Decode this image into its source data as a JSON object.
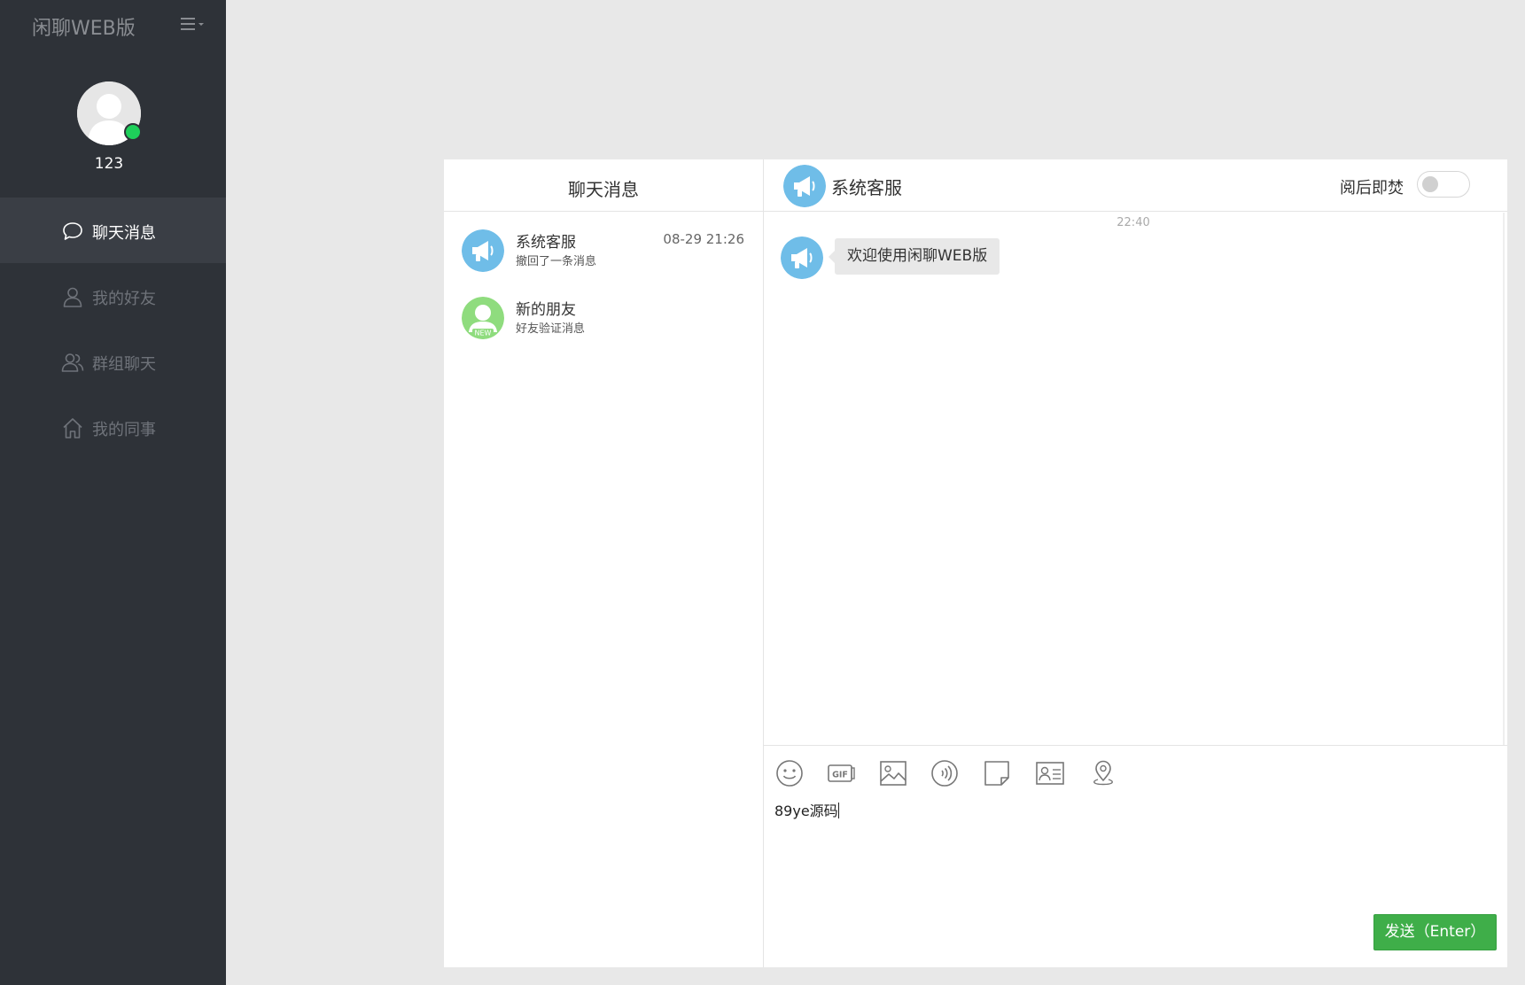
{
  "app": {
    "title": "闲聊WEB版"
  },
  "profile": {
    "username": "123",
    "status": "online"
  },
  "nav": {
    "items": [
      {
        "label": "聊天消息",
        "icon": "chat-bubble-icon",
        "active": true
      },
      {
        "label": "我的好友",
        "icon": "user-icon",
        "active": false
      },
      {
        "label": "群组聊天",
        "icon": "users-icon",
        "active": false
      },
      {
        "label": "我的同事",
        "icon": "home-icon",
        "active": false
      }
    ]
  },
  "conversations": {
    "header": "聊天消息",
    "items": [
      {
        "name": "系统客服",
        "preview": "撤回了一条消息",
        "time": "08-29 21:26",
        "avatar": "megaphone-icon"
      },
      {
        "name": "新的朋友",
        "preview": "好友验证消息",
        "time": "",
        "avatar": "new-friend-icon",
        "badge": "NEW"
      }
    ]
  },
  "chat": {
    "contact_name": "系统客服",
    "burn_after_read_label": "阅后即焚",
    "burn_after_read_enabled": false,
    "messages": [
      {
        "time": "22:40",
        "text": "欢迎使用闲聊WEB版",
        "sender": "系统客服"
      }
    ],
    "toolbar": [
      {
        "name": "emoji-icon"
      },
      {
        "name": "gif-icon"
      },
      {
        "name": "image-icon"
      },
      {
        "name": "voice-icon"
      },
      {
        "name": "file-icon"
      },
      {
        "name": "contact-card-icon"
      },
      {
        "name": "location-icon"
      }
    ],
    "draft": "89ye源码",
    "send_label": "发送（Enter）"
  },
  "colors": {
    "sidebar_bg": "#2e3238",
    "sidebar_active_bg": "#3a3e45",
    "page_bg": "#e8e8e8",
    "avatar_blue": "#6fbde8",
    "avatar_green": "#8fdc7e",
    "online_green": "#1ed05a",
    "send_green": "#3fae49"
  }
}
